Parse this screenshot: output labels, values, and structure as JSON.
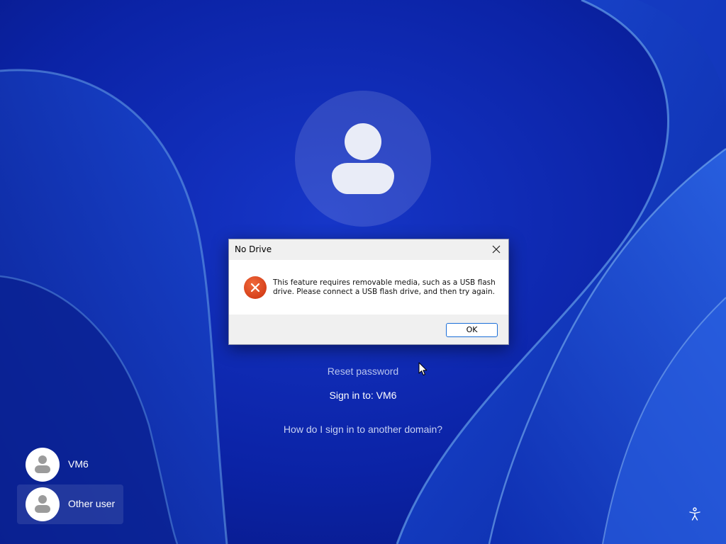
{
  "colors": {
    "wallpaper_base": "#0a1e9c",
    "error_icon": "#d9431e",
    "ok_border": "#1a6ed8",
    "link_text": "#b8c4ee"
  },
  "dialog": {
    "title": "No Drive",
    "message": "This feature requires removable media, such as a USB flash drive. Please connect a USB flash drive, and then try again.",
    "ok_label": "OK",
    "icon": "error-icon",
    "close_icon": "close-icon"
  },
  "login": {
    "reset_password": "Reset password",
    "sign_in_to": "Sign in to: VM6",
    "other_domain": "How do I sign in to another domain?"
  },
  "users": [
    {
      "name": "VM6",
      "selected": false
    },
    {
      "name": "Other user",
      "selected": true
    }
  ],
  "accessibility_icon": "ease-of-access-icon"
}
